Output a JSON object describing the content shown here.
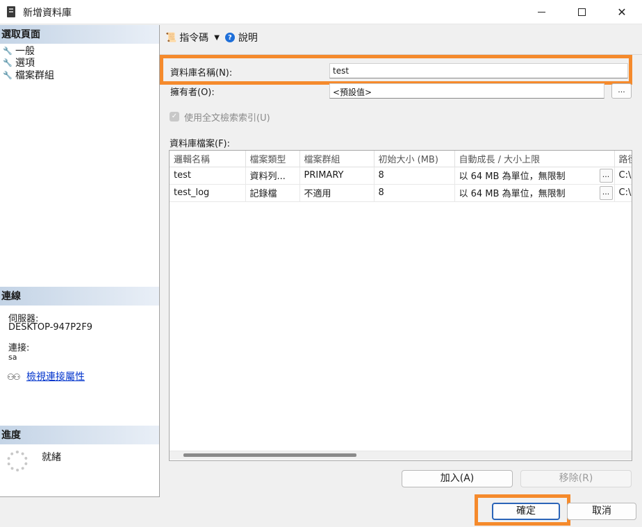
{
  "window": {
    "title": "新增資料庫"
  },
  "sidebar": {
    "select_page_header": "選取頁面",
    "pages": [
      {
        "label": "一般"
      },
      {
        "label": "選項"
      },
      {
        "label": "檔案群組"
      }
    ],
    "connection_header": "連線",
    "server_label": "伺服器:",
    "server_value": "DESKTOP-947P2F9",
    "connection_label": "連接:",
    "connection_value": "sa",
    "view_connection_link": "檢視連接屬性",
    "progress_header": "進度",
    "progress_status": "就緒"
  },
  "toolbar": {
    "script_label": "指令碼",
    "help_label": "說明"
  },
  "form": {
    "db_name_label": "資料庫名稱(N):",
    "db_name_value": "test",
    "owner_label": "擁有者(O):",
    "owner_value": "<預設值>",
    "owner_browse": "...",
    "fulltext_label": "使用全文檢索索引(U)",
    "fulltext_checked": true,
    "db_files_label": "資料庫檔案(F):"
  },
  "files_table": {
    "columns": [
      "邏輯名稱",
      "檔案類型",
      "檔案群組",
      "初始大小 (MB)",
      "自動成長 / 大小上限",
      "路徑"
    ],
    "rows": [
      {
        "logical_name": "test",
        "file_type": "資料列...",
        "filegroup": "PRIMARY",
        "initial_size": "8",
        "autogrowth": "以 64 MB 為單位，無限制",
        "path": "C:\\"
      },
      {
        "logical_name": "test_log",
        "file_type": "記錄檔",
        "filegroup": "不適用",
        "initial_size": "8",
        "autogrowth": "以 64 MB 為單位，無限制",
        "path": "C:\\"
      }
    ],
    "cell_button": "..."
  },
  "buttons": {
    "add": "加入(A)",
    "remove": "移除(R)",
    "ok": "確定",
    "cancel": "取消"
  },
  "colors": {
    "highlight": "#f58a2c",
    "link": "#0033cc",
    "header_gradient_start": "#c4d4e6"
  }
}
